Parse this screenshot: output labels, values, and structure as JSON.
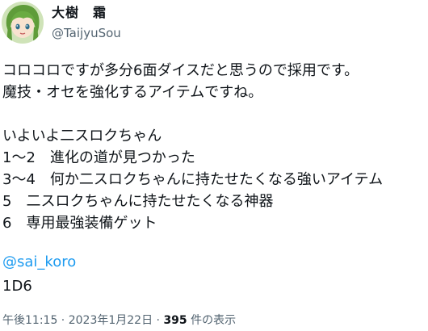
{
  "author": {
    "display_name": "大樹　霜",
    "handle": "@TaijyuSou"
  },
  "tweet": {
    "lines": [
      "コロコロですが多分6面ダイスだと思うので採用です。",
      "魔技・オセを強化するアイテムですね。",
      "",
      "いよいよ二スロクちゃん",
      "1〜2　進化の道が見つかった",
      "3〜4　何か二スロクちゃんに持たせたくなる強いアイテム",
      "5　二スロクちゃんに持たせたくなる神器",
      "6　専用最強装備ゲット"
    ],
    "mention": "@sai_koro",
    "dice": "1D6"
  },
  "meta": {
    "time": "午後11:15",
    "separator_1": " · ",
    "date": "2023年1月22日",
    "separator_2": " · ",
    "views_count": "395",
    "views_label": " 件の表示"
  },
  "colors": {
    "link": "#1d9bf0",
    "secondary_text": "#536471",
    "primary_text": "#0f1419"
  }
}
